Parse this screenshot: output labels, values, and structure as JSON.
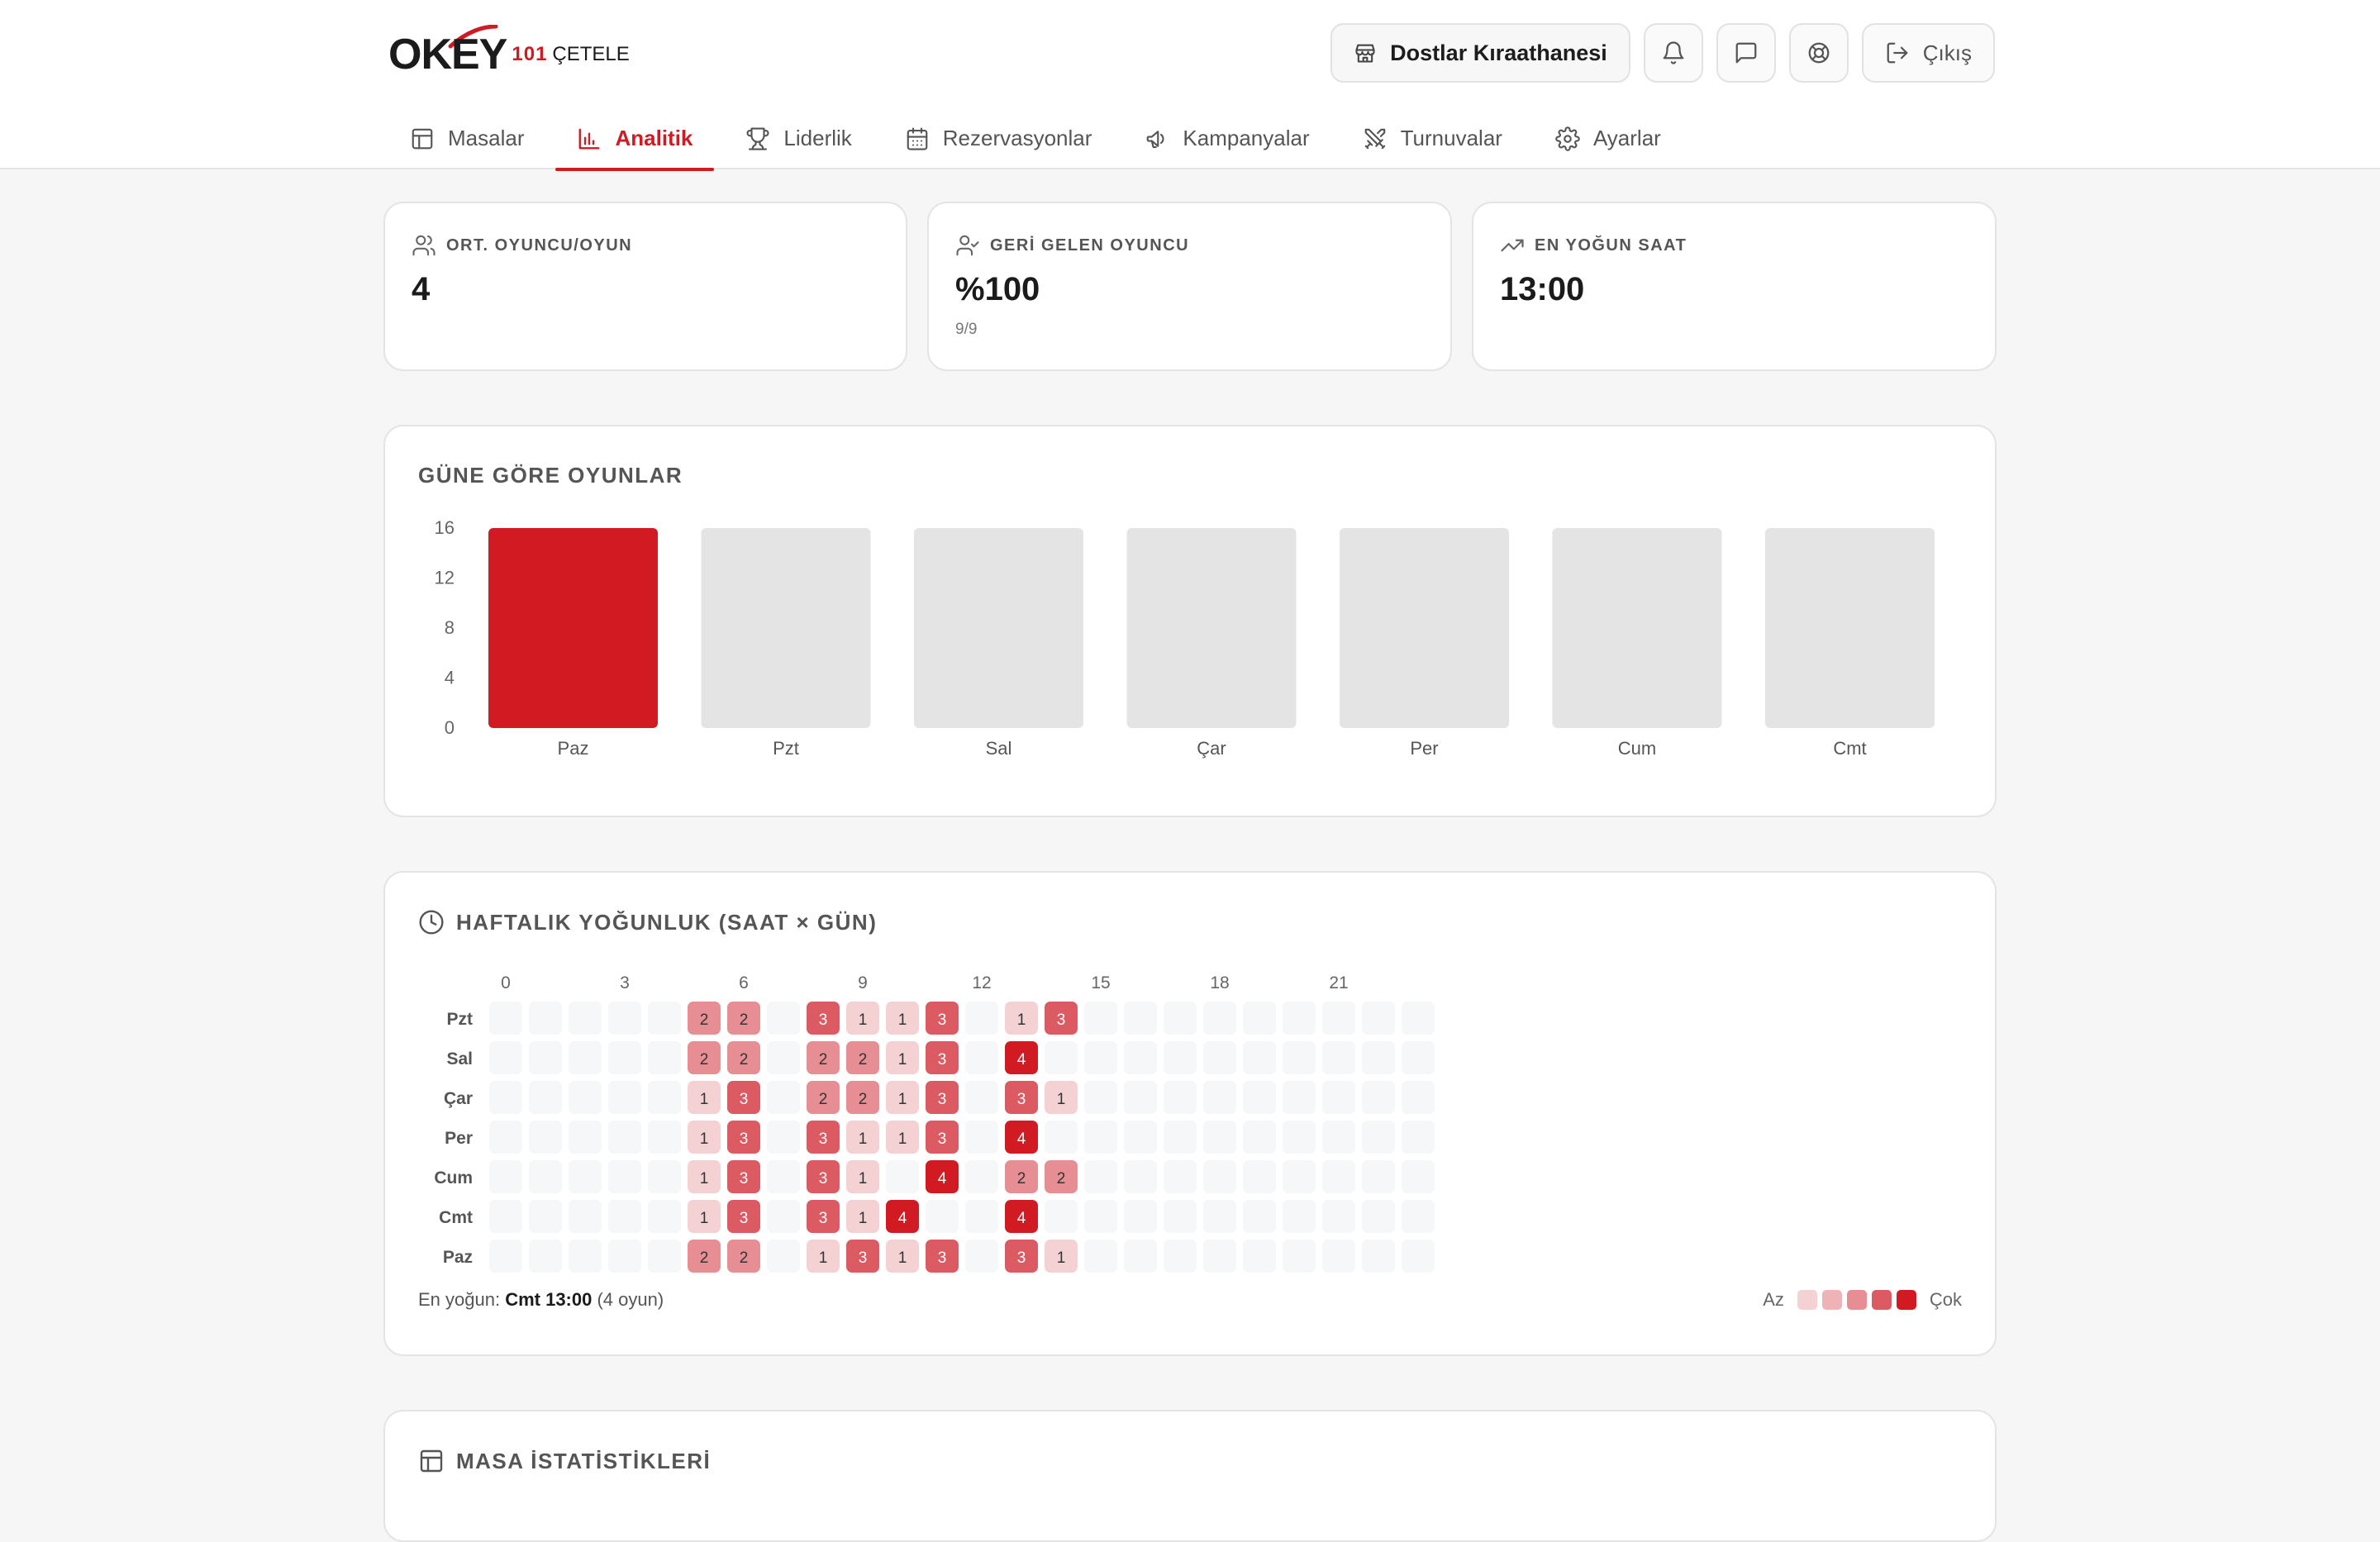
{
  "app": {
    "logo_main": "OKEY",
    "logo_sub1": "101",
    "logo_sub2": "ÇETELE"
  },
  "header": {
    "store_name": "Dostlar Kıraathanesi",
    "logout_label": "Çıkış"
  },
  "nav": [
    {
      "label": "Masalar",
      "icon": "table-icon",
      "active": false
    },
    {
      "label": "Analitik",
      "icon": "bar-chart-icon",
      "active": true
    },
    {
      "label": "Liderlik",
      "icon": "trophy-icon",
      "active": false
    },
    {
      "label": "Rezervasyonlar",
      "icon": "calendar-icon",
      "active": false
    },
    {
      "label": "Kampanyalar",
      "icon": "megaphone-icon",
      "active": false
    },
    {
      "label": "Turnuvalar",
      "icon": "swords-icon",
      "active": false
    },
    {
      "label": "Ayarlar",
      "icon": "gear-icon",
      "active": false
    }
  ],
  "stats": [
    {
      "label": "ORT. OYUNCU/OYUN",
      "value": "4",
      "sub": "",
      "icon": "users-icon"
    },
    {
      "label": "GERİ GELEN OYUNCU",
      "value": "%100",
      "sub": "9/9",
      "icon": "user-check-icon"
    },
    {
      "label": "EN YOĞUN SAAT",
      "value": "13:00",
      "sub": "",
      "icon": "trending-up-icon"
    }
  ],
  "games_by_day": {
    "title": "GÜNE GÖRE OYUNLAR"
  },
  "heatmap": {
    "title": "HAFTALIK YOĞUNLUK (SAAT × GÜN)",
    "peak_prefix": "En yoğun:",
    "peak_value": "Cmt 13:00",
    "peak_suffix": "(4 oyun)",
    "legend_low": "Az",
    "legend_high": "Çok"
  },
  "table_stats": {
    "title": "MASA İSTATİSTİKLERİ"
  },
  "colors": {
    "accent": "#d11a22",
    "bar_empty": "#e4e4e4",
    "heat_empty": "#f6f7f9",
    "heat_scale": [
      "#f4d2d4",
      "#efb3b7",
      "#e68e94",
      "#dc5a62",
      "#d11a22"
    ]
  },
  "chart_data": [
    {
      "type": "bar",
      "categories": [
        "Paz",
        "Pzt",
        "Sal",
        "Çar",
        "Per",
        "Cum",
        "Cmt"
      ],
      "values": [
        16,
        0,
        0,
        0,
        0,
        0,
        0
      ],
      "yticks": [
        0,
        4,
        8,
        12,
        16
      ],
      "ylim": [
        0,
        16
      ]
    },
    {
      "type": "heatmap",
      "rows": [
        "Pzt",
        "Sal",
        "Çar",
        "Per",
        "Cum",
        "Cmt",
        "Paz"
      ],
      "x_tick_labels": [
        {
          "hour": 0,
          "label": "0"
        },
        {
          "hour": 3,
          "label": "3"
        },
        {
          "hour": 6,
          "label": "6"
        },
        {
          "hour": 9,
          "label": "9"
        },
        {
          "hour": 12,
          "label": "12"
        },
        {
          "hour": 15,
          "label": "15"
        },
        {
          "hour": 18,
          "label": "18"
        },
        {
          "hour": 21,
          "label": "21"
        }
      ],
      "values": [
        [
          0,
          0,
          0,
          0,
          0,
          2,
          2,
          0,
          3,
          1,
          1,
          3,
          0,
          1,
          3,
          0,
          0,
          0,
          0,
          0,
          0,
          0,
          0,
          0
        ],
        [
          0,
          0,
          0,
          0,
          0,
          2,
          2,
          0,
          2,
          2,
          1,
          3,
          0,
          4,
          0,
          0,
          0,
          0,
          0,
          0,
          0,
          0,
          0,
          0
        ],
        [
          0,
          0,
          0,
          0,
          0,
          1,
          3,
          0,
          2,
          2,
          1,
          3,
          0,
          3,
          1,
          0,
          0,
          0,
          0,
          0,
          0,
          0,
          0,
          0
        ],
        [
          0,
          0,
          0,
          0,
          0,
          1,
          3,
          0,
          3,
          1,
          1,
          3,
          0,
          4,
          0,
          0,
          0,
          0,
          0,
          0,
          0,
          0,
          0,
          0
        ],
        [
          0,
          0,
          0,
          0,
          0,
          1,
          3,
          0,
          3,
          1,
          0,
          4,
          0,
          2,
          2,
          0,
          0,
          0,
          0,
          0,
          0,
          0,
          0,
          0
        ],
        [
          0,
          0,
          0,
          0,
          0,
          1,
          3,
          0,
          3,
          1,
          4,
          0,
          0,
          4,
          0,
          0,
          0,
          0,
          0,
          0,
          0,
          0,
          0,
          0
        ],
        [
          0,
          0,
          0,
          0,
          0,
          2,
          2,
          0,
          1,
          3,
          1,
          3,
          0,
          3,
          1,
          0,
          0,
          0,
          0,
          0,
          0,
          0,
          0,
          0
        ]
      ]
    }
  ]
}
